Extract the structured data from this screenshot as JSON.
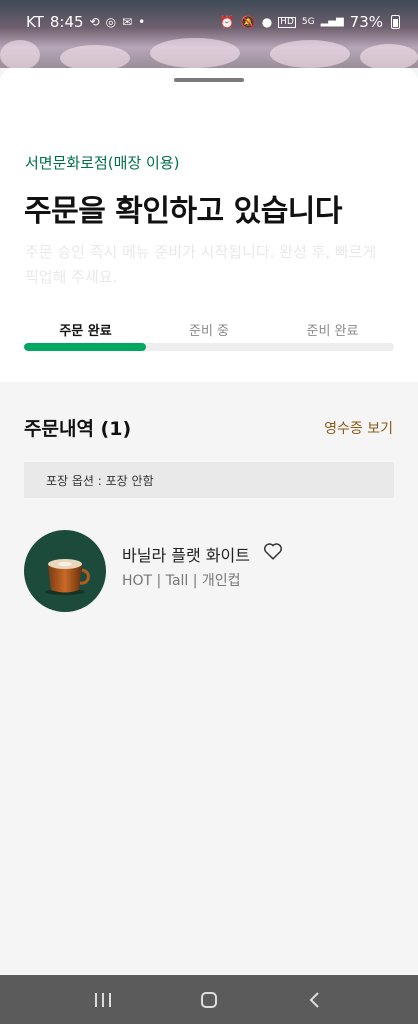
{
  "status_bar": {
    "carrier": "KT",
    "time": "8:45",
    "battery": "73%",
    "left_icons": [
      "sync-icon",
      "instagram-icon",
      "talk-icon",
      "dot-icon"
    ],
    "right_icons": [
      "alarm-icon",
      "mute-icon",
      "location-icon",
      "hd-icon",
      "5g-icon",
      "signal-icon",
      "battery-icon"
    ],
    "left_glyphs": [
      "⟲",
      "◎",
      "✉",
      "•"
    ],
    "right_glyphs": [
      "⏰",
      "🔕",
      "●",
      "HD",
      "5G",
      "▂▄▆"
    ]
  },
  "sheet": {
    "store_name": "서면문화로점(매장 이용)",
    "headline": "주문을 확인하고 있습니다",
    "subtext": "주문 승인 즉시 메뉴 준비가 시작됩니다. 완성 후, 빠르게 픽업해 주세요.",
    "steps": [
      "주문 완료",
      "준비 중",
      "준비 완료"
    ],
    "active_step": 0,
    "progress_fraction": 0.33
  },
  "order_history": {
    "title": "주문내역 (1)",
    "receipt_label": "영수증 보기",
    "packing_option": "포장 옵션 : 포장 안함",
    "items": [
      {
        "name": "바닐라 플랫 화이트",
        "options": "HOT | Tall | 개인컵",
        "favorite_icon": "heart-outline-icon"
      }
    ]
  },
  "colors": {
    "brand_green": "#00704a",
    "progress_green": "#00a862",
    "receipt_brown": "#8a5a1a",
    "thumb_bg": "#1d4b3b"
  },
  "nav_bar": {
    "buttons": [
      "recent-apps-icon",
      "home-icon",
      "back-icon"
    ]
  }
}
